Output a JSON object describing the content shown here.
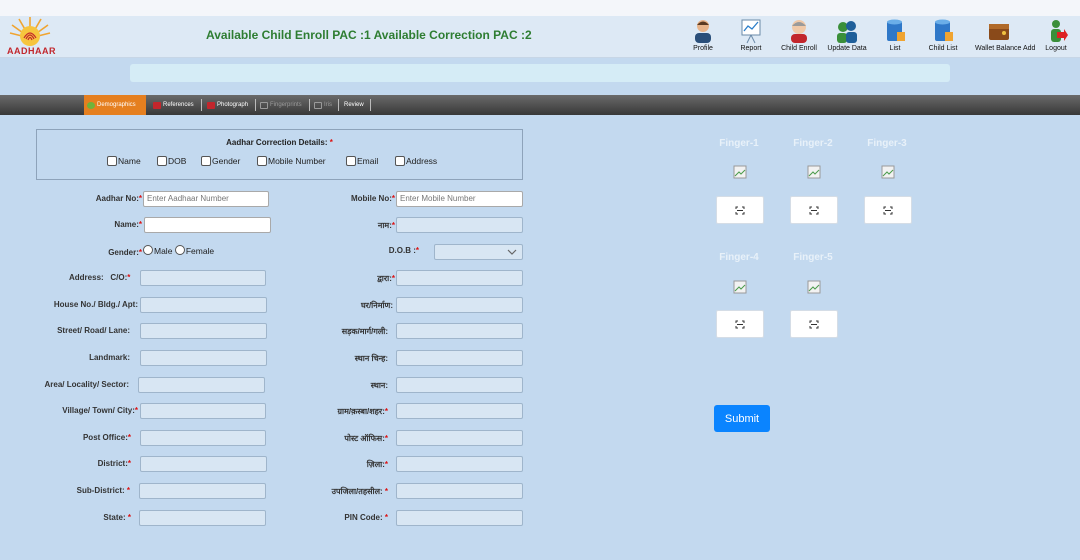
{
  "header": {
    "logo_text": "AADHAAR",
    "pac_status": "Available Child Enroll PAC :1 Available Correction PAC :2",
    "nav": [
      {
        "label": "Profile",
        "icon": "profile-icon"
      },
      {
        "label": "Report",
        "icon": "report-icon"
      },
      {
        "label": "Child Enroll",
        "icon": "child-enroll-icon"
      },
      {
        "label": "Update Data",
        "icon": "update-data-icon"
      },
      {
        "label": "List",
        "icon": "database-icon"
      },
      {
        "label": "Child List",
        "icon": "child-list-icon"
      },
      {
        "label": "Wallet Balance Add",
        "icon": "wallet-icon"
      },
      {
        "label": "Logout",
        "icon": "logout-icon"
      }
    ]
  },
  "tabs": [
    {
      "label": "Demographics",
      "state": "active"
    },
    {
      "label": "References",
      "state": "pending"
    },
    {
      "label": "Photograph",
      "state": "pending"
    },
    {
      "label": "Fingerprints",
      "state": "disabled"
    },
    {
      "label": "Iris",
      "state": "disabled"
    },
    {
      "label": "Review",
      "state": "normal"
    }
  ],
  "correction": {
    "title": "Aadhar Correction Details:",
    "required_mark": "*",
    "options": [
      "Name",
      "DOB",
      "Gender",
      "Mobile Number",
      "Email",
      "Address"
    ]
  },
  "form": {
    "aadhar_no": {
      "label": "Aadhar No:",
      "req": "*",
      "placeholder": "Enter Aadhaar Number"
    },
    "mobile_no": {
      "label": "Mobile No:",
      "req": "*",
      "placeholder": "Enter Mobile Number"
    },
    "name": {
      "label": "Name:",
      "req": "*"
    },
    "name_hi": {
      "label": "नाम:",
      "req": "*"
    },
    "gender": {
      "label": "Gender:",
      "req": "*",
      "options": [
        "Male",
        "Female"
      ]
    },
    "dob": {
      "label": "D.O.B :",
      "req": "*"
    },
    "address": {
      "label": "Address:",
      "sublabel": "C/O:",
      "req": "*"
    },
    "address_hi": {
      "label": "द्वारा:",
      "req": "*"
    },
    "house": {
      "label": "House No./ Bldg./ Apt:"
    },
    "house_hi": {
      "label": "घर/निर्माण:"
    },
    "street": {
      "label": "Street/ Road/ Lane:"
    },
    "street_hi": {
      "label": "सड़क/मार्ग/गली:"
    },
    "landmark": {
      "label": "Landmark:"
    },
    "landmark_hi": {
      "label": "स्थान चिन्ह:"
    },
    "area": {
      "label": "Area/ Locality/ Sector:"
    },
    "area_hi": {
      "label": "स्थान:"
    },
    "village": {
      "label": "Village/ Town/ City:",
      "req": "*"
    },
    "village_hi": {
      "label": "ग्राम/क़स्बा/शहर:",
      "req": "*"
    },
    "post_office": {
      "label": "Post Office:",
      "req": "*"
    },
    "post_office_hi": {
      "label": "पोस्ट ऑफिस:",
      "req": "*"
    },
    "district": {
      "label": "District:",
      "req": "*"
    },
    "district_hi": {
      "label": "ज़िला:",
      "req": "*"
    },
    "sub_district": {
      "label": "Sub-District:",
      "req": " *"
    },
    "sub_district_hi": {
      "label": "उपजिला/तहसील:",
      "req": " *"
    },
    "state": {
      "label": "State:",
      "req": " *"
    },
    "pin_code": {
      "label": "PIN Code:",
      "req": " *"
    }
  },
  "fingers": [
    "Finger-1",
    "Finger-2",
    "Finger-3",
    "Finger-4",
    "Finger-5"
  ],
  "submit_label": "Submit",
  "colors": {
    "accent": "#0a84ff",
    "active_tab": "#e57f1f",
    "pac_text": "#2e7d32",
    "background": "#c3d9ef"
  }
}
